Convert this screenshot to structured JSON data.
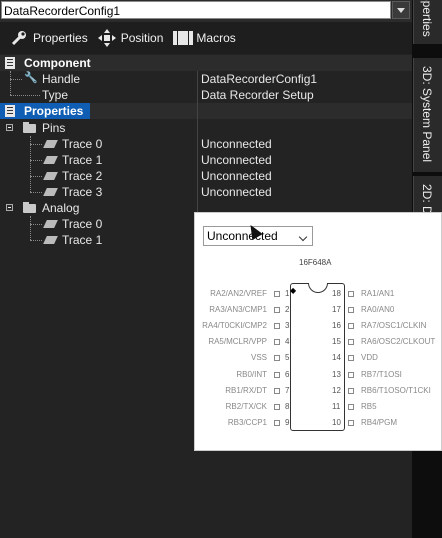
{
  "header": {
    "selector_value": "DataRecorderConfig1"
  },
  "toolbar": {
    "properties_label": "Properties",
    "position_label": "Position",
    "macros_label": "Macros"
  },
  "sections": {
    "component": "Component",
    "properties": "Properties"
  },
  "component_rows": [
    {
      "label": "Handle",
      "value": "DataRecorderConfig1"
    },
    {
      "label": "Type",
      "value": "Data Recorder Setup"
    }
  ],
  "groups": {
    "pins": "Pins",
    "analog": "Analog"
  },
  "pin_rows": [
    {
      "label": "Trace 0",
      "value": "Unconnected"
    },
    {
      "label": "Trace 1",
      "value": "Unconnected"
    },
    {
      "label": "Trace 2",
      "value": "Unconnected"
    },
    {
      "label": "Trace 3",
      "value": "Unconnected"
    }
  ],
  "analog_rows": [
    {
      "label": "Trace 0",
      "value": ""
    },
    {
      "label": "Trace 1",
      "value": ""
    }
  ],
  "side_tabs": {
    "tab1": "operties",
    "tab2": "3D: System Panel",
    "tab3": "2D: D"
  },
  "popup": {
    "dropdown_value": "Unconnected",
    "chip_name": "16F648A",
    "left_pins": [
      "RA2/AN2/VREF",
      "RA3/AN3/CMP1",
      "RA4/T0CKI/CMP2",
      "RA5/MCLR/VPP",
      "VSS",
      "RB0/INT",
      "RB1/RX/DT",
      "RB2/TX/CK",
      "RB3/CCP1"
    ],
    "left_nums": [
      "1",
      "2",
      "3",
      "4",
      "5",
      "6",
      "7",
      "8",
      "9"
    ],
    "right_pins": [
      "RA1/AN1",
      "RA0/AN0",
      "RA7/OSC1/CLKIN",
      "RA6/OSC2/CLKOUT",
      "VDD",
      "RB7/T1OSI",
      "RB6/T1OSO/T1CKI",
      "RB5",
      "RB4/PGM"
    ],
    "right_nums": [
      "18",
      "17",
      "16",
      "15",
      "14",
      "13",
      "12",
      "11",
      "10"
    ]
  },
  "icons": [
    "wrench-icon",
    "position-icon",
    "macros-icon",
    "component-icon",
    "properties-icon",
    "folder-icon",
    "pen-icon"
  ]
}
